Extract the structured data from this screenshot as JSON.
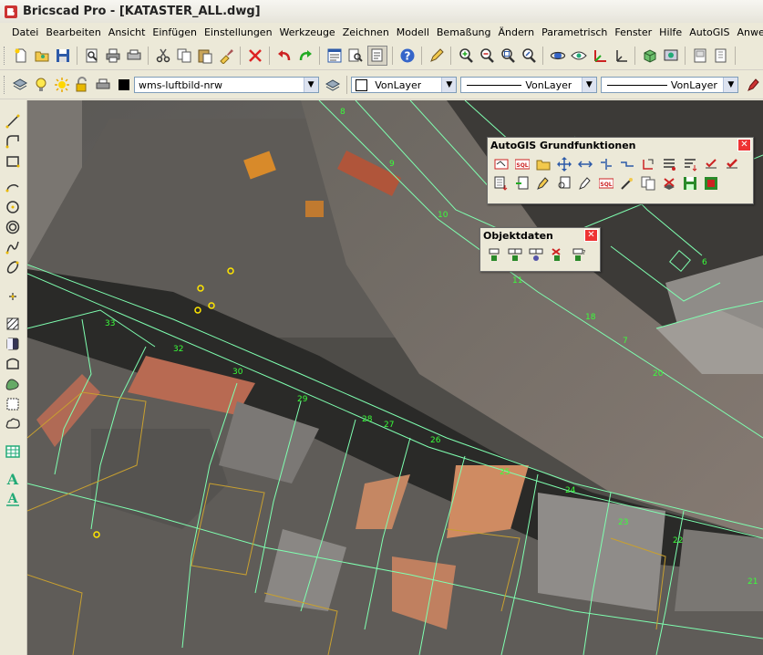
{
  "window": {
    "title": "Bricscad Pro - [KATASTER_ALL.dwg]"
  },
  "menu": [
    "Datei",
    "Bearbeiten",
    "Ansicht",
    "Einfügen",
    "Einstellungen",
    "Werkzeuge",
    "Zeichnen",
    "Modell",
    "Bemaßung",
    "Ändern",
    "Parametrisch",
    "Fenster",
    "Hilfe",
    "AutoGIS",
    "Anwendung"
  ],
  "layer_toolbar": {
    "layer_value": "wms-luftbild-nrw",
    "color_value": "VonLayer",
    "linetype_value": "VonLayer",
    "lineweight_value": "VonLayer"
  },
  "panels": {
    "grundfunktionen": {
      "title": "AutoGIS Grundfunktionen"
    },
    "objektdaten": {
      "title": "Objektdaten"
    }
  },
  "map_labels": [
    "33",
    "32",
    "30",
    "29",
    "28",
    "27",
    "26",
    "25",
    "24",
    "23",
    "22",
    "21",
    "20",
    "18",
    "11",
    "10",
    "9",
    "8",
    "7",
    "6"
  ],
  "colors": {
    "parcel_line": "#7fffb0",
    "building_line": "#c8a030",
    "label": "#39ff39"
  }
}
